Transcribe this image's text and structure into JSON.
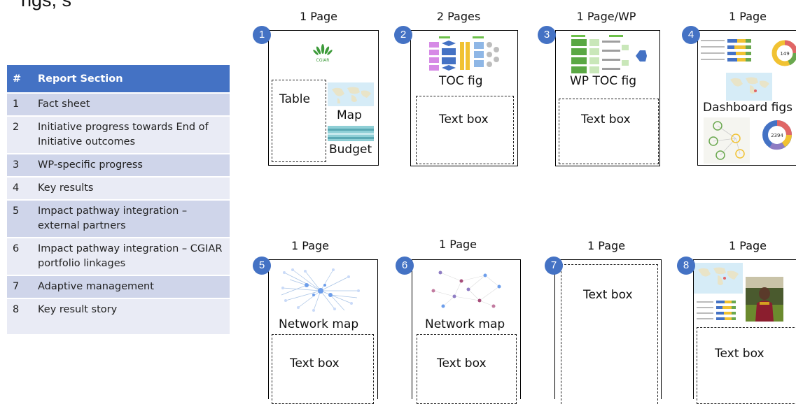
{
  "top_fragment": "ngs, s",
  "table": {
    "header": {
      "num": "#",
      "section": "Report Section"
    },
    "rows": [
      {
        "num": "1",
        "section": "Fact sheet"
      },
      {
        "num": "2",
        "section": "Initiative progress towards End of Initiative outcomes"
      },
      {
        "num": "3",
        "section": "WP-specific progress"
      },
      {
        "num": "4",
        "section": "Key results"
      },
      {
        "num": "5",
        "section": "Impact pathway integration – external partners"
      },
      {
        "num": "6",
        "section": "Impact pathway integration – CGIAR portfolio linkages"
      },
      {
        "num": "7",
        "section": "Adaptive management"
      },
      {
        "num": "8",
        "section": "Key result story"
      }
    ]
  },
  "pages": [
    {
      "num": "1",
      "count_label": "1 Page",
      "logo_text": "CGIAR",
      "table_label": "Table",
      "map_label": "Map",
      "budget_label": "Budget"
    },
    {
      "num": "2",
      "count_label": "2 Pages",
      "fig_label": "TOC fig",
      "text_label": "Text box"
    },
    {
      "num": "3",
      "count_label": "1 Page/WP",
      "fig_label": "WP TOC fig",
      "text_label": "Text box"
    },
    {
      "num": "4",
      "count_label": "1 Page",
      "fig_label": "Dashboard figs",
      "donut1_value": "149",
      "donut2_value": "2394"
    },
    {
      "num": "5",
      "count_label": "1 Page",
      "fig_label": "Network map",
      "text_label": "Text box"
    },
    {
      "num": "6",
      "count_label": "1 Page",
      "fig_label": "Network map",
      "text_label": "Text box"
    },
    {
      "num": "7",
      "count_label": "1 Page",
      "text_label": "Text box"
    },
    {
      "num": "8",
      "count_label": "1 Page",
      "text_label": "Text box"
    }
  ],
  "colors": {
    "accent": "#4472c4",
    "row_dark": "#cfd5ea",
    "row_light": "#e9ebf5"
  }
}
